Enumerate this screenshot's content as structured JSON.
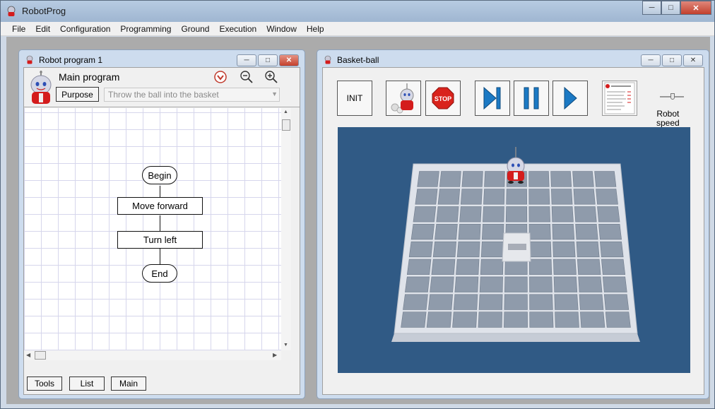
{
  "app": {
    "title": "RobotProg",
    "menu": [
      "File",
      "Edit",
      "Configuration",
      "Programming",
      "Ground",
      "Execution",
      "Window",
      "Help"
    ]
  },
  "program_window": {
    "title": "Robot program 1",
    "main_title": "Main program",
    "purpose_label": "Purpose",
    "purpose_text": "Throw the ball into the basket",
    "flowchart": {
      "begin": "Begin",
      "step1": "Move forward",
      "step2": "Turn left",
      "end": "End"
    },
    "tabs": {
      "tools": "Tools",
      "list": "List",
      "main": "Main"
    }
  },
  "basket_window": {
    "title": "Basket-ball",
    "init_label": "INIT",
    "stop_label": "STOP",
    "speed_label_1": "Robot",
    "speed_label_2": "speed"
  },
  "colors": {
    "scene_bg": "#305a85",
    "stop_red": "#d9231c",
    "play_blue": "#1b79c4",
    "robot_red": "#d41c1c"
  }
}
